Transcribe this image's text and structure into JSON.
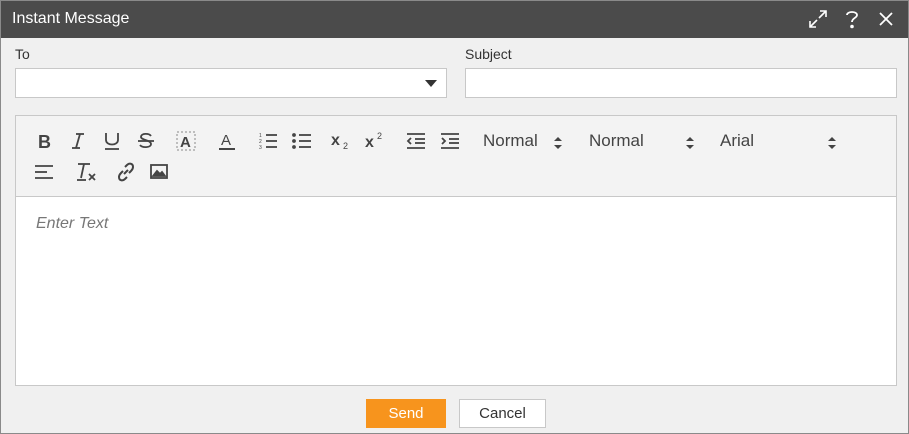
{
  "window": {
    "title": "Instant Message",
    "controls": [
      {
        "name": "expand-icon"
      },
      {
        "name": "help-icon"
      },
      {
        "name": "close-icon"
      }
    ]
  },
  "form": {
    "to_label": "To",
    "to_value": "",
    "subject_label": "Subject",
    "subject_value": ""
  },
  "toolbar": {
    "row1_tools": [
      "bold-icon",
      "italic-icon",
      "underline-icon",
      "strikethrough-icon",
      "background-color-icon",
      "font-color-icon",
      "ordered-list-icon",
      "bullet-list-icon",
      "subscript-icon",
      "superscript-icon",
      "outdent-icon",
      "indent-icon"
    ],
    "header_picker": "Normal",
    "size_picker": "Normal",
    "font_picker": "Arial",
    "row2_tools": [
      "align-icon",
      "clear-format-icon",
      "link-icon",
      "image-icon"
    ]
  },
  "editor": {
    "placeholder": "Enter Text",
    "content": ""
  },
  "actions": {
    "send_label": "Send",
    "cancel_label": "Cancel"
  },
  "colors": {
    "titlebar": "#4b4b4b",
    "accent": "#f7941d"
  }
}
